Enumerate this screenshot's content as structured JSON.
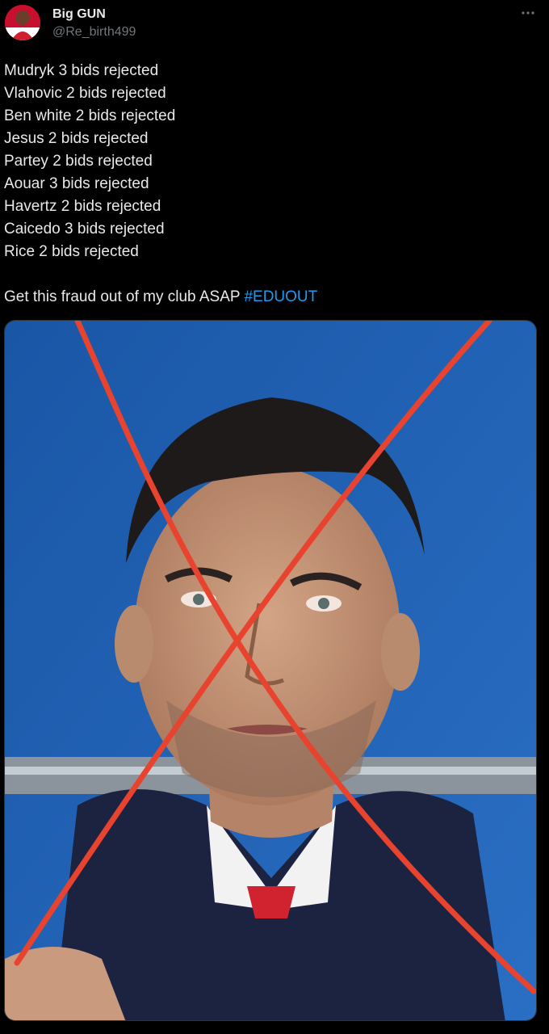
{
  "tweet": {
    "author": {
      "display_name": "Big GUN",
      "handle": "@Re_birth499",
      "avatar_icon": "avatar"
    },
    "menu_icon": "more-dots-icon",
    "lines": [
      "Mudryk 3 bids rejected",
      "Vlahovic 2 bids rejected",
      "Ben white 2 bids rejected",
      "Jesus 2 bids rejected",
      "Partey 2 bids rejected",
      "Aouar 3 bids rejected",
      "Havertz 2 bids rejected",
      "Caicedo 3 bids rejected",
      "Rice 2 bids rejected"
    ],
    "closing_text": "Get this fraud out of my club ASAP ",
    "hashtag": "#EDUOUT"
  },
  "colors": {
    "background": "#000000",
    "text": "#e7e9ea",
    "secondary_text": "#71767b",
    "link": "#1d9bf0",
    "red_cross": "#e8432e",
    "photo_background": "#1f5fb0"
  }
}
